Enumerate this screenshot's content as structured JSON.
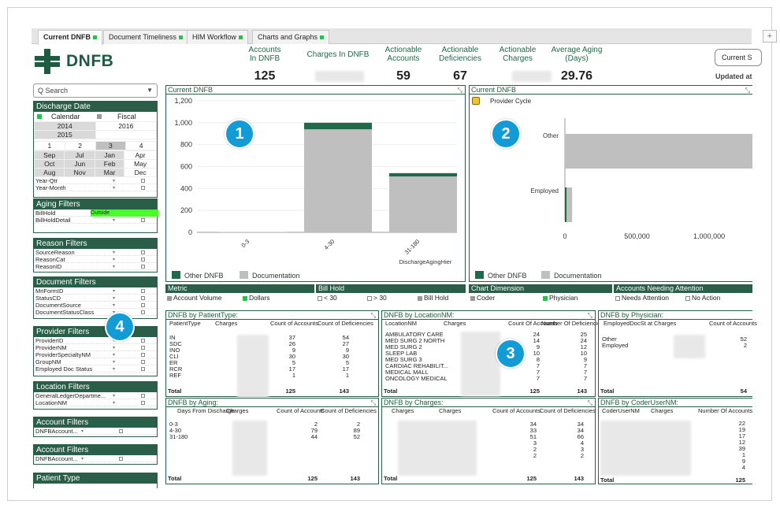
{
  "tabs": [
    {
      "label": "Current DNFB",
      "status": "active"
    },
    {
      "label": "Document Timeliness"
    },
    {
      "label": "HIM Workflow"
    },
    {
      "label": "Charts and Graphs"
    }
  ],
  "plus_label": "+",
  "app": {
    "title": "DNFB"
  },
  "kpis": [
    {
      "label": "Accounts In DNFB",
      "value": "125"
    },
    {
      "label": "Charges In DNFB",
      "value": ""
    },
    {
      "label": "Actionable Accounts",
      "value": "59"
    },
    {
      "label": "Actionable Deficiencies",
      "value": "67"
    },
    {
      "label": "Actionable Charges",
      "value": ""
    },
    {
      "label": "Average Aging (Days)",
      "value": "29.76"
    }
  ],
  "current_button": "Current S",
  "updated_label": "Updated at",
  "search": {
    "placeholder": "Search"
  },
  "sidebar": {
    "discharge_date": {
      "title": "Discharge Date",
      "calendar": "Calendar",
      "fiscal": "Fiscal",
      "years": [
        "2014",
        "2016",
        "2015"
      ],
      "quarters": [
        "1",
        "2",
        "3",
        "4"
      ],
      "months": [
        [
          "Sep",
          "Jul",
          "Jan",
          "Apr"
        ],
        [
          "Oct",
          "Jun",
          "Feb",
          "May"
        ],
        [
          "Aug",
          "Nov",
          "Mar",
          "Dec"
        ]
      ],
      "fields": [
        "Year-Qtr",
        "Year-Month"
      ]
    },
    "aging": {
      "title": "Aging Filters",
      "fields": [
        "BillHold",
        "BillHoldDetail"
      ],
      "billhold_value": "Outside"
    },
    "reason": {
      "title": "Reason Filters",
      "fields": [
        "SourceReason",
        "ReasonCat",
        "ReasonID"
      ]
    },
    "document": {
      "title": "Document Filters",
      "fields": [
        "MriFormID",
        "StatusCD",
        "DocumentSource",
        "DocumentStatusClass"
      ]
    },
    "provider": {
      "title": "Provider Filters",
      "fields": [
        "ProviderID",
        "ProviderNM",
        "ProviderSpecialtyNM",
        "GroupNM",
        "Employed Doc Status"
      ]
    },
    "location": {
      "title": "Location Filters",
      "fields": [
        "GeneralLedgerDepartme...",
        "LocationNM"
      ]
    },
    "account1": {
      "title": "Account Filters",
      "fields": [
        "DNFBAccount..."
      ]
    },
    "account2": {
      "title": "Account Filters",
      "fields": [
        "DNFBAccount..."
      ]
    },
    "patient": {
      "title": "Patient Type"
    }
  },
  "chart1": {
    "title": "Current DNFB",
    "axis_title": "DischargeAgingHier",
    "legend": [
      "Other DNFB",
      "Documentation"
    ]
  },
  "chart2": {
    "title": "Current DNFB",
    "subtitle": "Provider Cycle",
    "legend": [
      "Other DNFB",
      "Documentation"
    ]
  },
  "chart_data": [
    {
      "type": "bar",
      "stacked": true,
      "categories": [
        "0-3",
        "4-30",
        "31-180"
      ],
      "series": [
        {
          "name": "Documentation",
          "values": [
            3,
            940,
            510
          ]
        },
        {
          "name": "Other DNFB",
          "values": [
            0,
            60,
            30
          ]
        }
      ],
      "ylim": [
        0,
        1200
      ],
      "yticks": [
        0,
        200,
        400,
        600,
        800,
        1000,
        1200
      ],
      "xlabel": "DischargeAgingHier",
      "colors": {
        "Documentation": "#bfbfbf",
        "Other DNFB": "#1e6a4a"
      }
    },
    {
      "type": "bar",
      "orientation": "horizontal",
      "categories": [
        "Other",
        "Employed"
      ],
      "series": [
        {
          "name": "Documentation",
          "values": [
            1300000,
            50000
          ]
        },
        {
          "name": "Other DNFB",
          "values": [
            0,
            8000
          ]
        }
      ],
      "xticks": [
        0,
        500000,
        1000000
      ],
      "colors": {
        "Documentation": "#bfbfbf",
        "Other DNFB": "#1e6a4a"
      }
    }
  ],
  "dims": {
    "metric": {
      "title": "Metric",
      "options": [
        "Account Volume",
        "Dollars"
      ]
    },
    "billhold": {
      "title": "Bill Hold",
      "options": [
        "< 30",
        "> 30",
        "Bill Hold"
      ]
    },
    "chartdim": {
      "title": "Chart Dimension",
      "options": [
        "Coder",
        "Physician"
      ]
    },
    "attention": {
      "title": "Accounts Needing Attention",
      "options": [
        "Needs Attention",
        "No Action"
      ]
    }
  },
  "tables": {
    "patient_type": {
      "title": "DNFB by PatientType:",
      "headers": [
        "PatientType",
        "Charges",
        "Count of Accounts",
        "Count of Deficiencies"
      ],
      "rows": [
        [
          "IN",
          "37",
          "54"
        ],
        [
          "SDC",
          "26",
          "27"
        ],
        [
          "INO",
          "9",
          "9"
        ],
        [
          "CLI",
          "30",
          "30"
        ],
        [
          "ER",
          "5",
          "5"
        ],
        [
          "RCR",
          "17",
          "17"
        ],
        [
          "REF",
          "1",
          "1"
        ]
      ],
      "total": [
        "Total",
        "125",
        "143"
      ]
    },
    "location": {
      "title": "DNFB by LocationNM:",
      "headers": [
        "LocationNM",
        "Charges",
        "Count Of Accounts",
        "Number Of Deficiencies"
      ],
      "rows": [
        [
          "AMBULATORY CARE",
          "24",
          "25"
        ],
        [
          "MED SURG 2 NORTH",
          "14",
          "24"
        ],
        [
          "MED SURG 2",
          "9",
          "12"
        ],
        [
          "SLEEP LAB",
          "10",
          "10"
        ],
        [
          "MED SURG 3",
          "8",
          "9"
        ],
        [
          "CARDIAC REHABILIT...",
          "7",
          "7"
        ],
        [
          "MEDICAL MALL",
          "7",
          "7"
        ],
        [
          "ONCOLOGY MEDICAL",
          "7",
          "7"
        ]
      ],
      "total": [
        "Total",
        "125",
        "143"
      ]
    },
    "physician": {
      "title": "DNFB by Physician:",
      "headers": [
        "EmployedDocSt at",
        "Charges",
        "Count of Accounts"
      ],
      "rows": [
        [
          "Other",
          "52"
        ],
        [
          "Employed",
          "2"
        ]
      ],
      "total": [
        "Total",
        "54"
      ]
    },
    "aging": {
      "title": "DNFB by Aging:",
      "headers": [
        "Days From Discharge",
        "Charges",
        "Count of Accounts",
        "Count of Deficiencies"
      ],
      "rows": [
        [
          "0-3",
          "2",
          "2"
        ],
        [
          "4-30",
          "79",
          "89"
        ],
        [
          "31-180",
          "44",
          "52"
        ]
      ],
      "total": [
        "Total",
        "125",
        "143"
      ]
    },
    "charges": {
      "title": "DNFB by Charges:",
      "headers": [
        "Charges",
        "Charges",
        "Count of Accounts",
        "Count of Deficiencies"
      ],
      "rows": [
        [
          "34",
          "34"
        ],
        [
          "33",
          "34"
        ],
        [
          "51",
          "66"
        ],
        [
          "3",
          "4"
        ],
        [
          "2",
          "3"
        ],
        [
          "2",
          "2"
        ]
      ],
      "total": [
        "Total",
        "125",
        "143"
      ]
    },
    "coder": {
      "title": "DNFB by CoderUserNM:",
      "headers": [
        "CoderUserNM",
        "Charges",
        "Number Of Accounts"
      ],
      "rows": [
        [
          "22"
        ],
        [
          "19"
        ],
        [
          "17"
        ],
        [
          "12"
        ],
        [
          "39"
        ],
        [
          "1"
        ],
        [
          "9"
        ],
        [
          "4"
        ]
      ],
      "total": [
        "Total",
        "125"
      ]
    }
  },
  "badges": [
    "1",
    "2",
    "3",
    "4"
  ]
}
